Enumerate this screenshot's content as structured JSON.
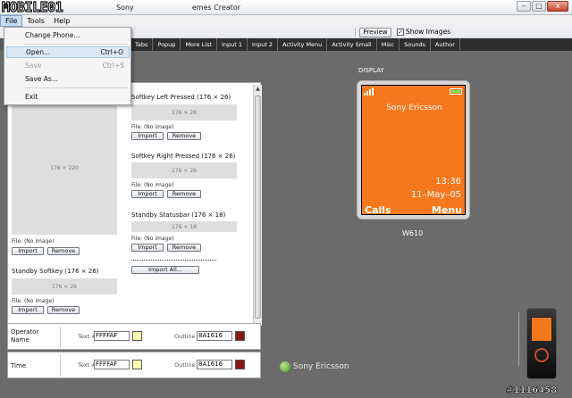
{
  "window": {
    "watermark": "MOBILE01",
    "title_fragments": [
      "Sony",
      "emes Creator"
    ],
    "controls": {
      "minimize": "–",
      "maximize": "□",
      "close": "x"
    }
  },
  "menubar": {
    "items": [
      "File",
      "Tools",
      "Help"
    ]
  },
  "file_menu": {
    "items": [
      {
        "label": "Change Phone...",
        "shortcut": "",
        "enabled": true
      },
      {
        "label": "Open...",
        "shortcut": "Ctrl+O",
        "enabled": true
      },
      {
        "label": "Save",
        "shortcut": "Ctrl+S",
        "enabled": false
      },
      {
        "label": "Save As...",
        "shortcut": "",
        "enabled": true
      },
      {
        "label": "Exit",
        "shortcut": "",
        "enabled": true
      }
    ]
  },
  "toolbar": {
    "preview_label": "Preview",
    "show_images_label": "Show Images",
    "show_images_checked": true
  },
  "tabs": [
    "Tabs",
    "Popup",
    "More List",
    "Input 1",
    "Input 2",
    "Activity Menu",
    "Activity Small",
    "Misc",
    "Sounds",
    "Author"
  ],
  "left_panel": {
    "main_image_size": "176 × 220",
    "main_file": "File: (No image)",
    "standby_softkey": {
      "label": "Standby Softkey (176 × 26)",
      "size": "176 × 26",
      "file": "File: (No image)"
    },
    "softkey_left_pressed": {
      "label": "Softkey Left Pressed (176 × 26)",
      "size": "176 × 26",
      "file": "File: (No image)"
    },
    "softkey_right_pressed": {
      "label": "Softkey Right Pressed (176 × 26)",
      "size": "176 × 26",
      "file": "File: (No image)"
    },
    "standby_statusbar": {
      "label": "Standby Statusbar (176 × 18)",
      "size": "176 × 18",
      "file": "File: (No image)"
    },
    "import_label": "Import",
    "remove_label": "Remove",
    "import_all_label": "Import All..."
  },
  "color_rows": [
    {
      "label_lines": [
        "Operator",
        "Name"
      ],
      "text_label": "Text #",
      "text_value": "FFFFAF",
      "text_color": "#FFFFAF",
      "outline_label": "Outline #",
      "outline_value": "8A1616",
      "outline_color": "#8A1616"
    },
    {
      "label_lines": [
        "Time"
      ],
      "text_label": "Text #",
      "text_value": "FFFFAF",
      "text_color": "#FFFFAF",
      "outline_label": "Outline #",
      "outline_value": "8A1616",
      "outline_color": "#8A1616"
    }
  ],
  "display": {
    "label": "DISPLAY",
    "operator": "Sony Ericsson",
    "time": "13:36",
    "date": "11–May–05",
    "softkey_left": "Calls",
    "softkey_right": "Menu",
    "model": "W610",
    "screen_color": "#F6781C"
  },
  "brand": {
    "logo_text": "Sony Ericsson"
  },
  "watermark_id": "#1116458"
}
